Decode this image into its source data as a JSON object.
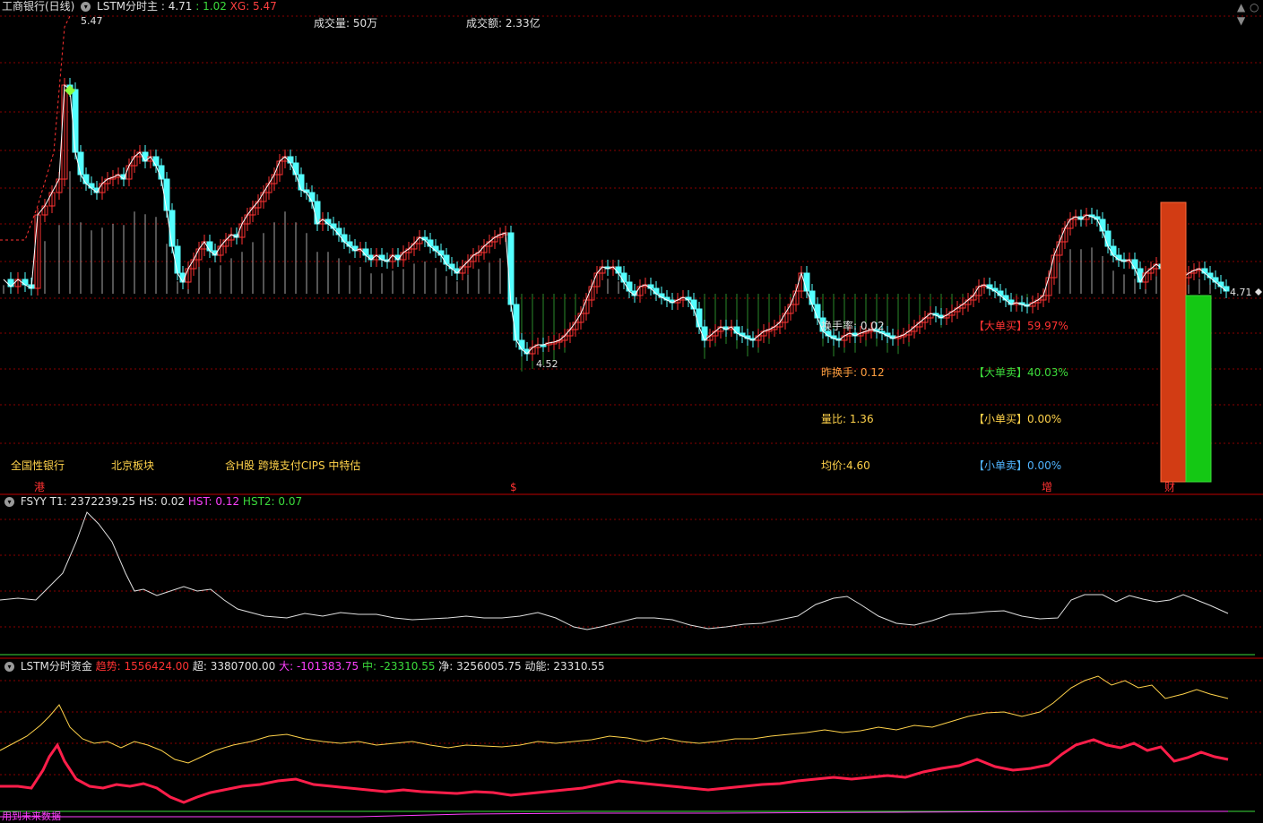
{
  "header": {
    "title": "工商银行(日线)",
    "indicator": "LSTM分时主",
    "value1_label": ": 4.71",
    "value2_label": ": 1.02",
    "value3_label": "XG: 5.47"
  },
  "window_controls": {
    "up": "▲",
    "down": "▼",
    "close": "○"
  },
  "top_info": {
    "volume": "成交量: 50万",
    "amount": "成交额: 2.33亿"
  },
  "price_labels": {
    "high": "5.47",
    "low": "4.52",
    "last": "4.71"
  },
  "stats": {
    "turnover": "换手率: 0.02",
    "prev_turnover": "昨换手: 0.12",
    "volume_ratio": "量比: 1.36",
    "avg_price": "均价:4.60",
    "big_buy": "【大单买】59.97%",
    "big_sell": "【大单卖】40.03%",
    "small_buy": "【小单买】0.00%",
    "small_sell": "【小单卖】0.00%"
  },
  "tags": [
    "全国性银行",
    "北京板块",
    "含H股 跨境支付CIPS 中特估"
  ],
  "markers": [
    "港",
    "$",
    "增",
    "财"
  ],
  "panel2": {
    "name": "FSYY",
    "t1": "T1: 2372239.25",
    "hs": "HS: 0.02",
    "hst": "HST: 0.12",
    "hst2": "HST2: 0.07"
  },
  "panel3": {
    "name": "LSTM分时资金",
    "trend": "趋势: 1556424.00",
    "super": "超: 3380700.00",
    "big": "大: -101383.75",
    "mid": "中: -23310.55",
    "net": "净: 3256005.75",
    "momentum": "动能: 23310.55",
    "footer": "用到未来数据"
  },
  "colors": {
    "up": "#ff3232",
    "down": "#54ffff",
    "grid": "#8a0000",
    "yellow": "#ffd24a",
    "pink": "#ff40ff",
    "green": "#00e600"
  }
}
